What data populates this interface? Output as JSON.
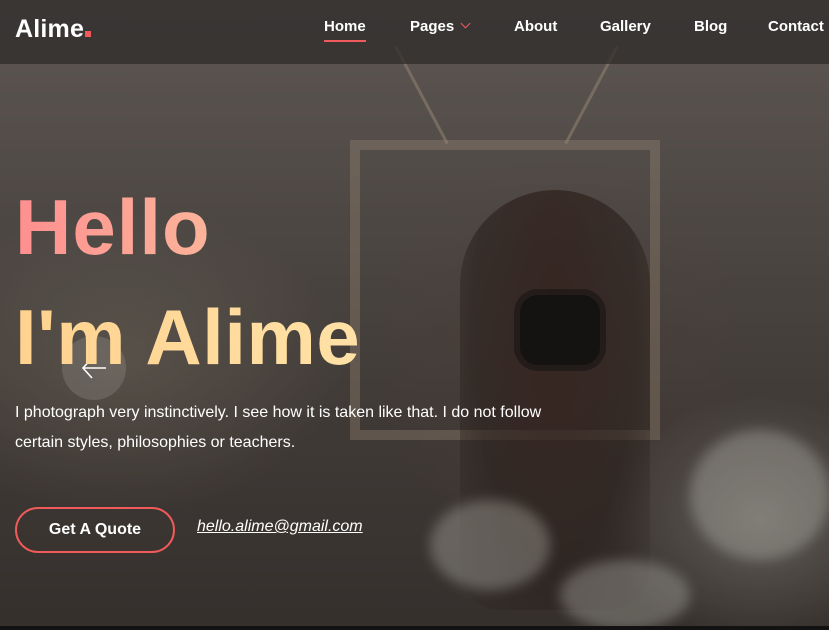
{
  "header": {
    "logo": "Alime",
    "nav": [
      {
        "label": "Home",
        "active": true
      },
      {
        "label": "Pages",
        "has_dropdown": true
      },
      {
        "label": "About"
      },
      {
        "label": "Gallery"
      },
      {
        "label": "Blog"
      },
      {
        "label": "Contact"
      }
    ]
  },
  "hero": {
    "greeting": "Hello",
    "name": "I'm Alime",
    "description_line1": "I photograph very instinctively. I see how it is taken like that. I do not follow",
    "description_line2": "certain styles, philosophies or teachers.",
    "cta_label": "Get A Quote",
    "email": "hello.alime@gmail.com",
    "prev_icon": "arrow-left-icon"
  },
  "colors": {
    "accent": "#f05a5a",
    "hello_gradient": [
      "#ff8f8f",
      "#fbb49a"
    ],
    "name_gradient": [
      "#ffd28f",
      "#ffe1a6"
    ]
  }
}
